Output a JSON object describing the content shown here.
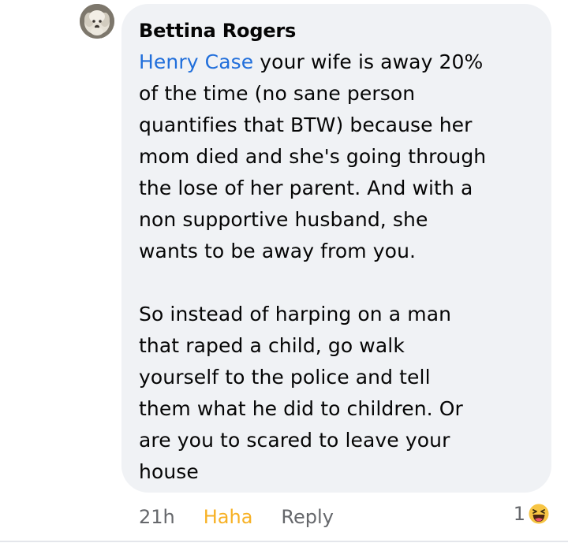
{
  "comment": {
    "author": "Bettina Rogers",
    "mention": "Henry Case",
    "paragraph1_lines": [
      " your wife is away 20%",
      "of the time (no sane person",
      "quantifies that BTW) because her",
      "mom died and she's going through",
      "the lose of her parent. And with a",
      "non supportive husband, she",
      "wants to be away from you."
    ],
    "paragraph2_lines": [
      "So instead of harping on a man",
      "that raped a child, go walk",
      "yourself to the police and tell",
      "them what he did to children. Or",
      "are you to scared to leave your",
      "house"
    ]
  },
  "actions": {
    "time": "21h",
    "reaction_label": "Haha",
    "reply_label": "Reply"
  },
  "reactions": {
    "count": "1",
    "icon": "haha-emoji-icon"
  },
  "colors": {
    "bubble_bg": "#f0f2f5",
    "mention": "#216fdb",
    "haha": "#f7b125",
    "meta": "#65676b"
  }
}
